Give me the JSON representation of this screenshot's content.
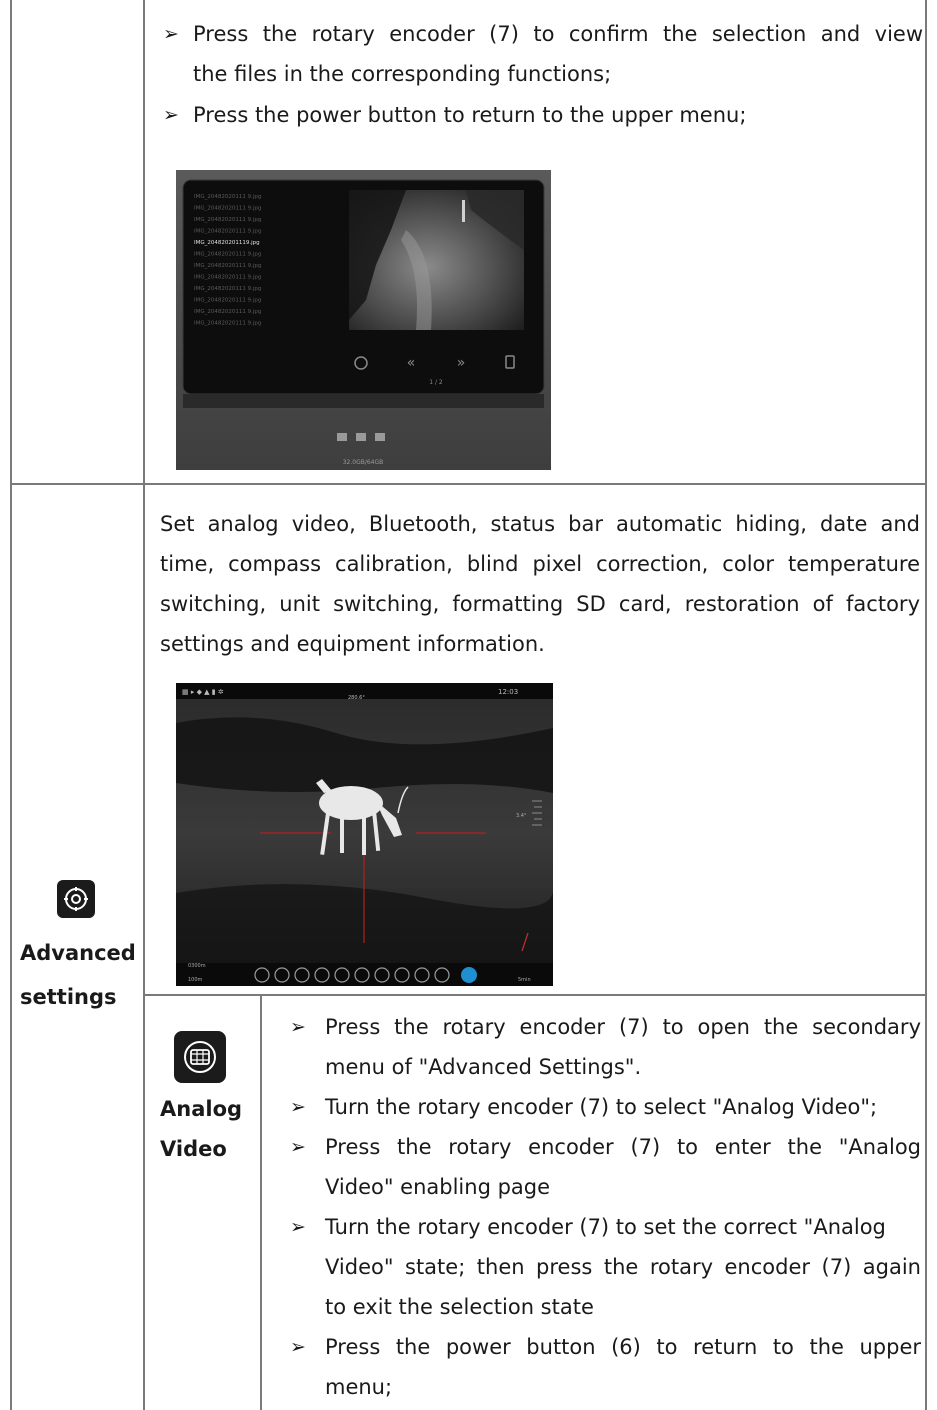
{
  "row1": {
    "bullet_glyph": "➢",
    "bullet1_line1": "Press the rotary encoder (7) to confirm the selection and view",
    "bullet1_line2": "the files in the corresponding functions;",
    "bullet2": "Press the power button to return to the upper menu;",
    "screenshot": {
      "files": [
        "IMG_20482020111 9.jpg",
        "IMG_20482020111 9.jpg",
        "IMG_20482020111 9.jpg",
        "IMG_20482020111 9.jpg",
        "IMG_204820201119.jpg",
        "IMG_20482020111 9.jpg",
        "IMG_20482020111 9.jpg",
        "IMG_20482020111 9.jpg",
        "IMG_20482020111 9.jpg",
        "IMG_20482020111 9.jpg",
        "IMG_20482020111 9.jpg",
        "IMG_20482020111 9.jpg"
      ],
      "page_indicator": "1 / 2",
      "storage": "32.0GB/64GB"
    }
  },
  "row2": {
    "label_line1": "Advanced",
    "label_line2": "settings",
    "desc_lines": [
      "Set analog video, Bluetooth, status bar automatic hiding, date and",
      "time, compass calibration, blind pixel correction, color temperature",
      "switching, unit switching, formatting SD card, restoration of factory",
      "settings and equipment information."
    ],
    "screenshot": {
      "clock": "12:03",
      "heading": "280.6°",
      "range_readout": "0300m",
      "zoom_readout": "100m",
      "timer": "5min",
      "incline": "3.4°"
    }
  },
  "subrow": {
    "label_line1": "Analog",
    "label_line2": "Video",
    "bullet_glyph": "➢",
    "bullets": [
      [
        "Press the rotary encoder (7) to open the secondary",
        "menu of \"Advanced Settings\"."
      ],
      [
        "Turn the rotary encoder (7) to select \"Analog Video\";"
      ],
      [
        "Press the rotary encoder (7) to enter the \"Analog",
        "Video\" enabling page"
      ],
      [
        "Turn the rotary encoder (7) to set the correct \"Analog",
        "Video\" state; then press the rotary encoder (7) again",
        "to exit the selection state"
      ],
      [
        "Press the power button (6) to return to the upper",
        "menu;"
      ]
    ]
  }
}
